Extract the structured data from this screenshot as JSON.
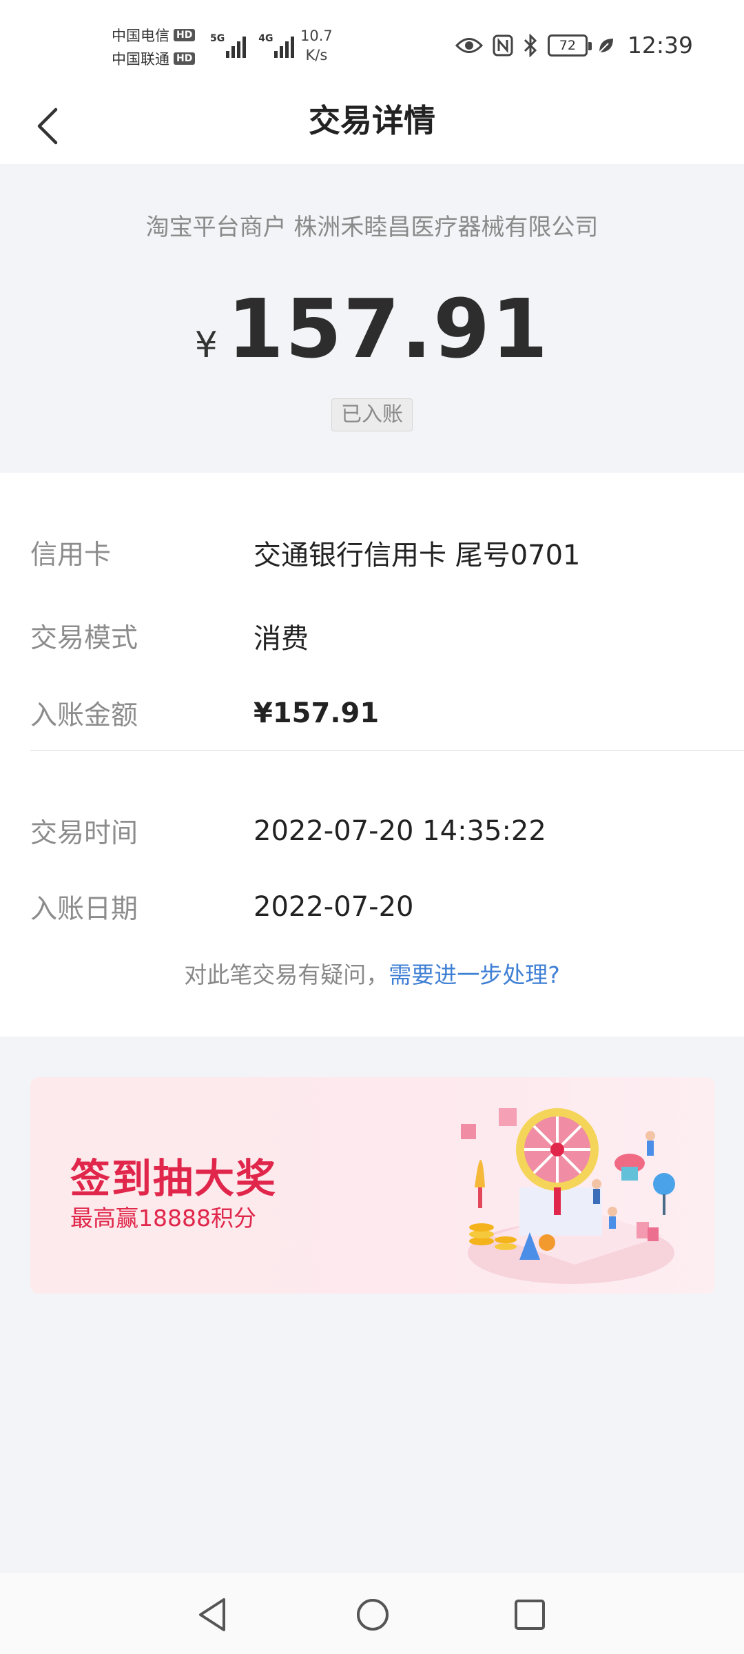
{
  "status_bar": {
    "carrier1": "中国电信",
    "carrier2": "中国联通",
    "hd": "HD",
    "net1": "5G",
    "net2": "4G",
    "speed_value": "10.7",
    "speed_unit": "K/s",
    "battery": "72",
    "time": "12:39"
  },
  "header": {
    "title": "交易详情"
  },
  "summary": {
    "merchant": "淘宝平台商户 株洲禾睦昌医疗器械有限公司",
    "currency": "¥",
    "amount": "157.91",
    "status": "已入账"
  },
  "details": {
    "card_label": "信用卡",
    "card_value": "交通银行信用卡 尾号0701",
    "mode_label": "交易模式",
    "mode_value": "消费",
    "posted_amount_label": "入账金额",
    "posted_amount_value": "¥157.91",
    "time_label": "交易时间",
    "time_value": "2022-07-20 14:35:22",
    "date_label": "入账日期",
    "date_value": "2022-07-20"
  },
  "help": {
    "question": "对此笔交易有疑问，",
    "link": "需要进一步处理?"
  },
  "promo": {
    "title": "签到抽大奖",
    "subtitle": "最高赢18888积分"
  },
  "colors": {
    "accent_red": "#e0264a",
    "link_blue": "#3f7fd4"
  },
  "icons": [
    "back-arrow-icon",
    "eye-icon",
    "nfc-icon",
    "bluetooth-icon",
    "battery-icon",
    "leaf-icon",
    "nav-back-icon",
    "nav-home-icon",
    "nav-recents-icon"
  ]
}
